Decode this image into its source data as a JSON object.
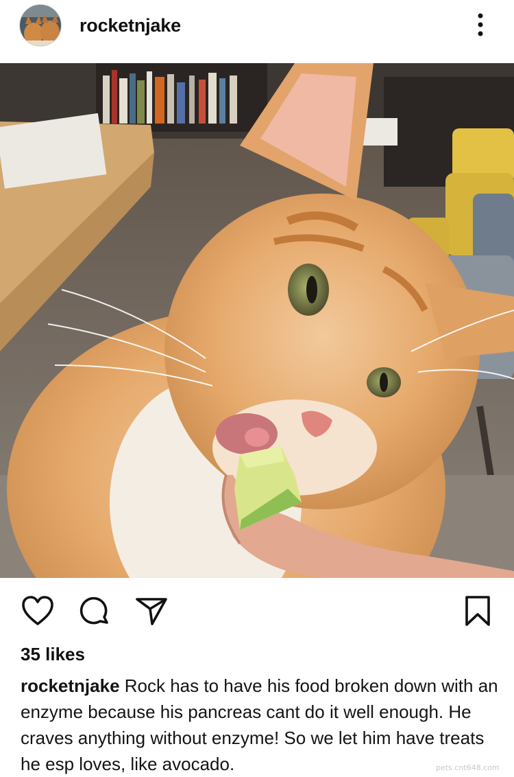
{
  "post": {
    "username": "rocketnjake",
    "likes": "35 likes",
    "caption_username": "rocketnjake",
    "caption_text": " Rock has to have his food broken down with an enzyme because his pancreas cant do it well enough.  He craves anything without enzyme!  So we let him have treats he esp loves, like avocado."
  },
  "icons": {
    "more": "more-options-icon",
    "like": "heart-icon",
    "comment": "comment-icon",
    "share": "share-icon",
    "save": "bookmark-icon"
  },
  "watermark": "pets.cnt648.com"
}
